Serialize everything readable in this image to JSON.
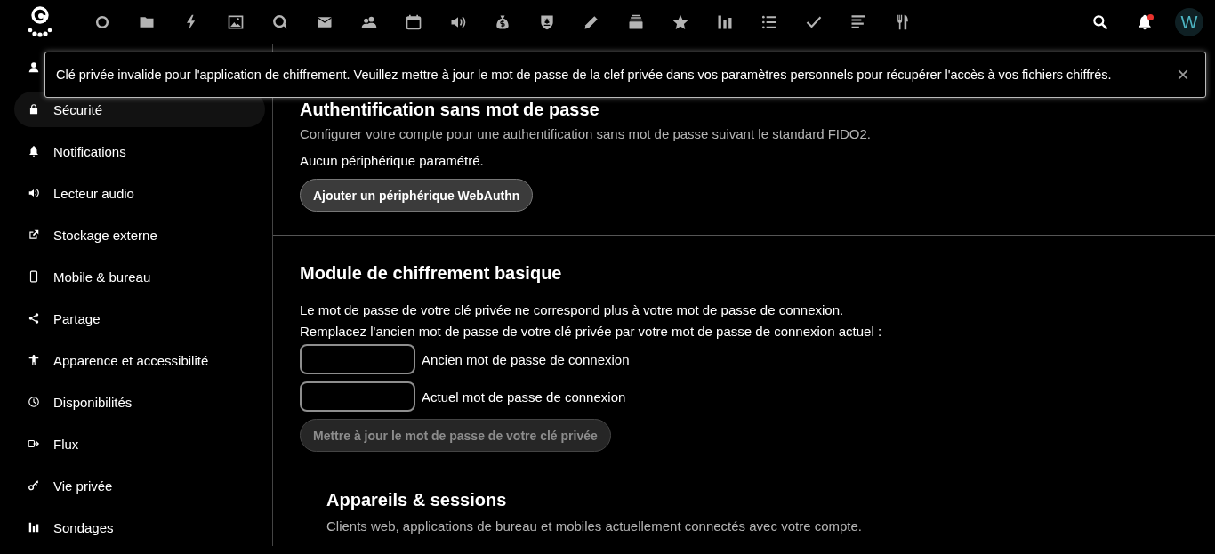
{
  "header": {
    "avatar": "W",
    "notifications": {
      "unread": true
    }
  },
  "toast": {
    "message": "Clé privée invalide pour l'application de chiffrement. Veuillez mettre à jour le mot de passe de la clef privée dans vos paramètres personnels pour récupérer l'accès à vos fichiers chiffrés.",
    "close": "×"
  },
  "sidebar": {
    "items": [
      {
        "selected": false
      },
      {
        "label": "Sécurité",
        "selected": true
      },
      {
        "label": "Notifications",
        "selected": false
      },
      {
        "label": "Lecteur audio",
        "selected": false
      },
      {
        "label": "Stockage externe",
        "selected": false
      },
      {
        "label": "Mobile & bureau",
        "selected": false
      },
      {
        "label": "Partage",
        "selected": false
      },
      {
        "label": "Apparence et accessibilité",
        "selected": false
      },
      {
        "label": "Disponibilités",
        "selected": false
      },
      {
        "label": "Flux",
        "selected": false
      },
      {
        "label": "Vie privée",
        "selected": false
      },
      {
        "label": "Sondages",
        "selected": false
      }
    ]
  },
  "sections": [
    {
      "title": "Authentification sans mot de passe",
      "paragraphs": [
        {
          "text": "Configurer votre compte pour une authentification sans mot de passe suivant le standard FIDO2.",
          "muted": true
        },
        {
          "text": "Aucun périphérique paramétré.",
          "muted": false
        }
      ],
      "button": {
        "label": "Ajouter un périphérique WebAuthn",
        "disabled": false
      }
    },
    {
      "title": "Module de chiffrement basique",
      "paragraphs": [
        {
          "text": "Le mot de passe de votre clé privée ne correspond plus à votre mot de passe de connexion.",
          "muted": false
        },
        {
          "text": "Remplacez l'ancien mot de passe de votre clé privée par votre mot de passe de connexion actuel :",
          "muted": false
        }
      ],
      "fields": [
        {
          "label": "Ancien mot de passe de connexion"
        },
        {
          "label": "Actuel mot de passe de connexion"
        }
      ],
      "button": {
        "label": "Mettre à jour le mot de passe de votre clé privée",
        "disabled": true
      }
    }
  ],
  "devices": {
    "title": "Appareils & sessions",
    "description": "Clients web, applications de bureau et mobiles actuellement connectés avec votre compte."
  }
}
